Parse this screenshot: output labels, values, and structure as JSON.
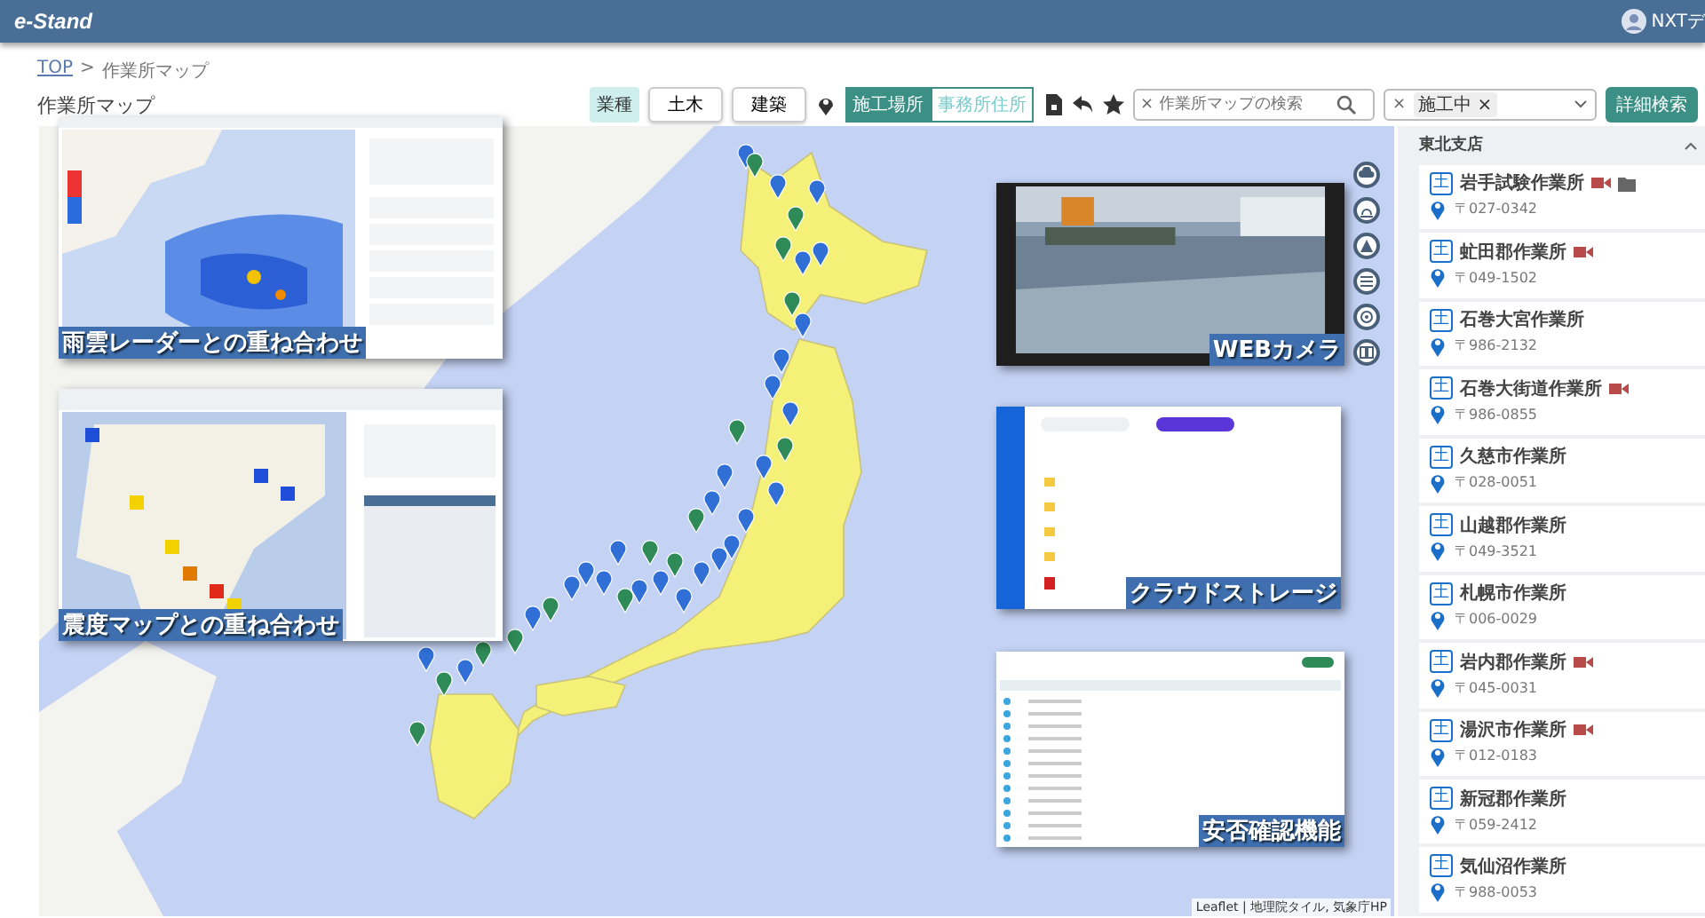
{
  "header": {
    "logo": "e-Stand",
    "user": "NXTデ"
  },
  "breadcrumb": [
    {
      "label": "TOP",
      "link": true
    },
    {
      "label": ">",
      "link": false
    },
    {
      "label": "作業所マップ",
      "link": false
    }
  ],
  "title": "作業所マップ",
  "toolbar": {
    "category_label": "業種",
    "category_buttons": [
      {
        "label": "土木",
        "selected": false
      },
      {
        "label": "建築",
        "selected": false
      }
    ],
    "location_toggle": [
      {
        "label": "施工場所",
        "selected": true
      },
      {
        "label": "事務所住所",
        "selected": false
      }
    ],
    "search": {
      "clear": "×",
      "placeholder": "作業所マップの検索"
    },
    "status_filter": {
      "clear": "×",
      "chips": [
        {
          "label": "施工中",
          "remove": "×"
        }
      ]
    },
    "detail_button": "詳細検索"
  },
  "map": {
    "overlays": [
      {
        "kind": "radar",
        "caption": "雨雲レーダーとの重ね合わせ"
      },
      {
        "kind": "quake",
        "caption": "震度マップとの重ね合わせ"
      },
      {
        "kind": "camera",
        "caption": "WEBカメラ"
      },
      {
        "kind": "storage",
        "caption": "クラウドストレージ"
      },
      {
        "kind": "safety",
        "caption": "安否確認機能"
      }
    ],
    "attribution": "Leaflet | 地理院タイル, 気象庁HP"
  },
  "sidebar": {
    "branch": "東北支店",
    "sites": [
      {
        "badge": "土",
        "name": "岩手試験作業所",
        "postal": "〒027-0342",
        "camera": true,
        "folder": true
      },
      {
        "badge": "土",
        "name": "虻田郡作業所",
        "postal": "〒049-1502",
        "camera": true,
        "folder": false
      },
      {
        "badge": "土",
        "name": "石巻大宮作業所",
        "postal": "〒986-2132",
        "camera": false,
        "folder": false
      },
      {
        "badge": "土",
        "name": "石巻大街道作業所",
        "postal": "〒986-0855",
        "camera": true,
        "folder": false
      },
      {
        "badge": "土",
        "name": "久慈市作業所",
        "postal": "〒028-0051",
        "camera": false,
        "folder": false
      },
      {
        "badge": "土",
        "name": "山越郡作業所",
        "postal": "〒049-3521",
        "camera": false,
        "folder": false
      },
      {
        "badge": "土",
        "name": "札幌市作業所",
        "postal": "〒006-0029",
        "camera": false,
        "folder": false
      },
      {
        "badge": "土",
        "name": "岩内郡作業所",
        "postal": "〒045-0031",
        "camera": true,
        "folder": false
      },
      {
        "badge": "土",
        "name": "湯沢市作業所",
        "postal": "〒012-0183",
        "camera": true,
        "folder": false
      },
      {
        "badge": "土",
        "name": "新冠郡作業所",
        "postal": "〒059-2412",
        "camera": false,
        "folder": false
      },
      {
        "badge": "土",
        "name": "気仙沼作業所",
        "postal": "〒988-0053",
        "camera": false,
        "folder": false
      }
    ]
  }
}
